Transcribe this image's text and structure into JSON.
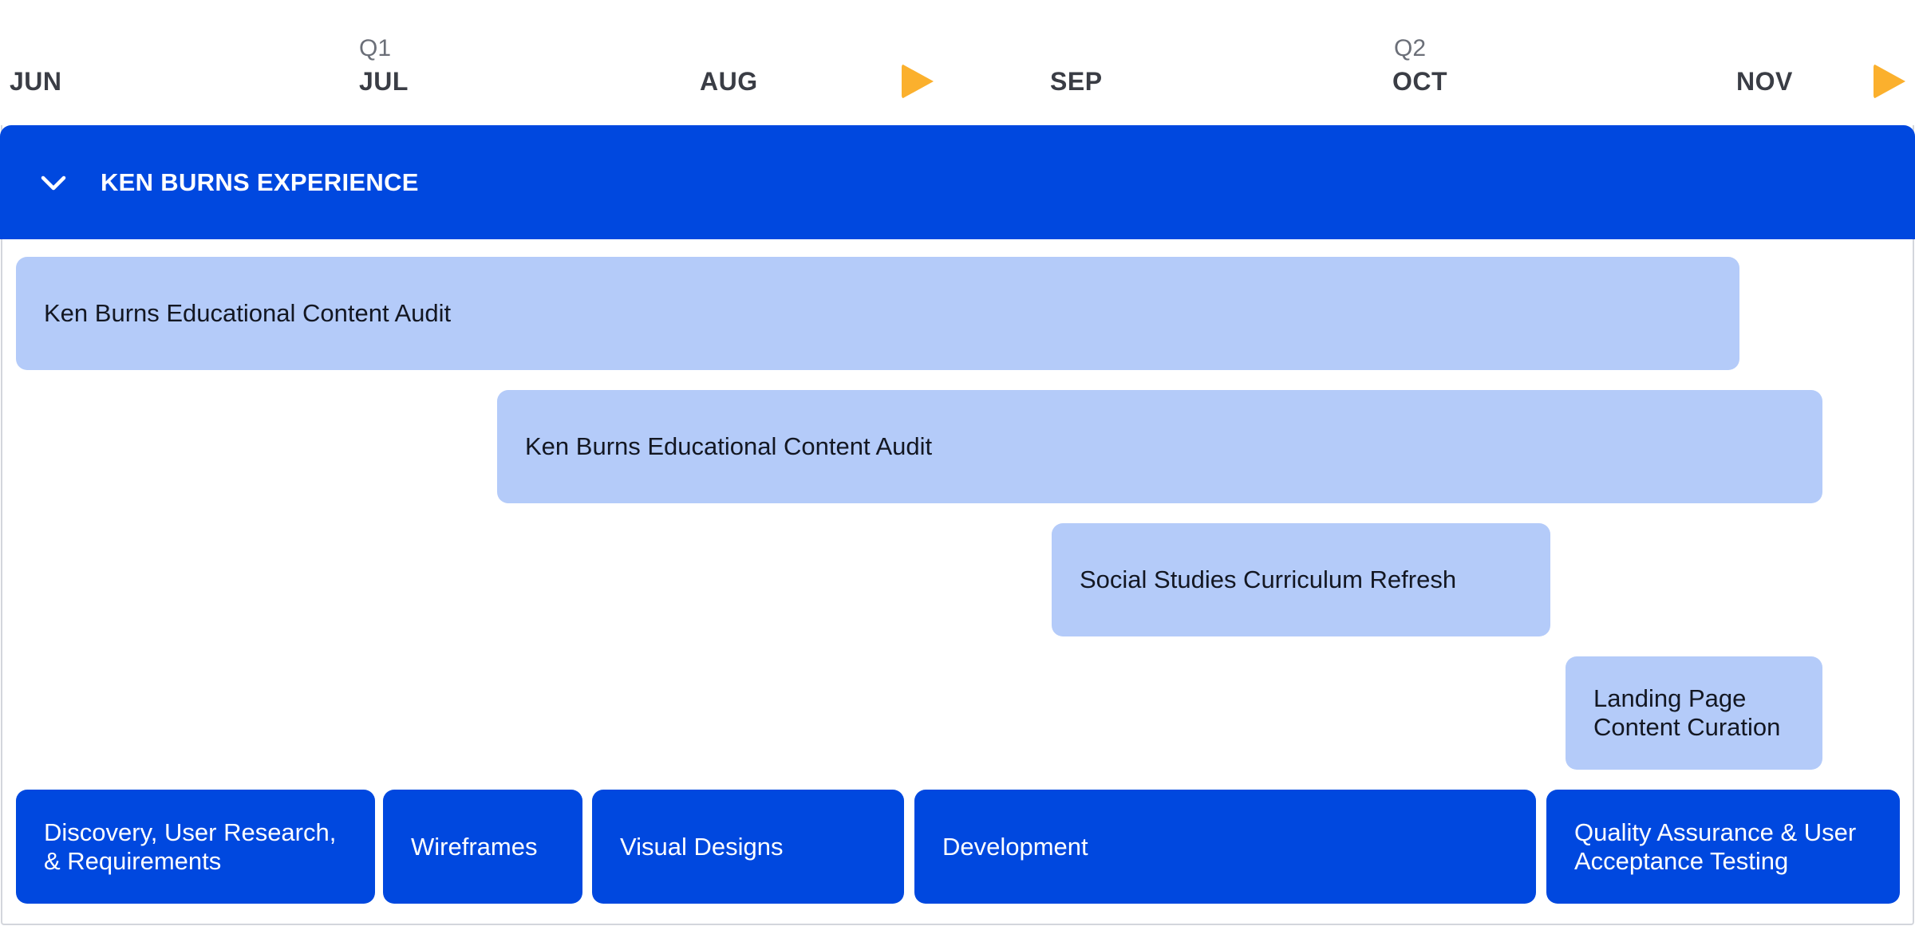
{
  "timeline": {
    "quarters": {
      "q1": "Q1",
      "q2": "Q2"
    },
    "months": {
      "jun": "JUN",
      "jul": "JUL",
      "aug": "AUG",
      "sep": "SEP",
      "oct": "OCT",
      "nov": "NOV"
    },
    "marker_color": "#fbb02d"
  },
  "group": {
    "title": "KEN BURNS EXPERIENCE",
    "toggle_icon": "chevron-down-icon",
    "color": "#0048df"
  },
  "initiatives": [
    {
      "label": "Ken Burns Educational Content Audit"
    },
    {
      "label": "Ken Burns Educational Content Audit"
    },
    {
      "label": "Social Studies Curriculum Refresh"
    },
    {
      "label": "Landing Page Content Curation"
    }
  ],
  "phases": [
    {
      "label": "Discovery, User Research, & Requirements"
    },
    {
      "label": "Wireframes"
    },
    {
      "label": "Visual Designs"
    },
    {
      "label": "Development"
    },
    {
      "label": "Quality Assurance & User Acceptance Testing"
    }
  ],
  "colors": {
    "initiative_bar": "#b4cbf9",
    "phase_bar": "#0048df"
  }
}
